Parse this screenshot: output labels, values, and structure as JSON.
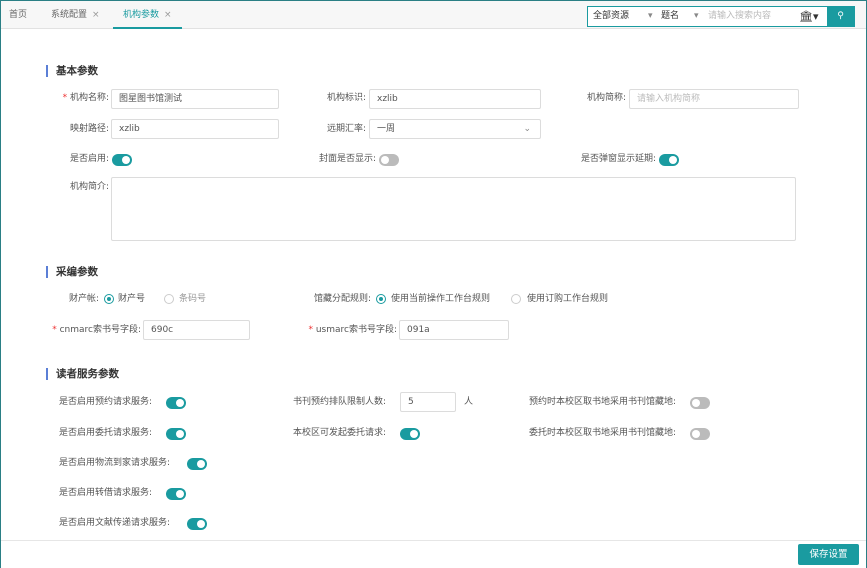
{
  "tabs": [
    {
      "label": "首页"
    },
    {
      "label": "系统配置",
      "close": "×"
    },
    {
      "label": "机构参数",
      "close": "×"
    }
  ],
  "search": {
    "scope": "全部资源",
    "field": "题名",
    "placeholder": "请输入搜索内容",
    "library_icon": "library-icon",
    "button_icon": "search-icon"
  },
  "basic": {
    "title": "基本参数",
    "name_label": "机构名称:",
    "name_value": "图星图书馆测试",
    "id_label": "机构标识:",
    "id_value": "xzlib",
    "abbr_label": "机构简称:",
    "abbr_placeholder": "请输入机构简称",
    "path_label": "映射路径:",
    "path_value": "xzlib",
    "rate_label": "远期汇率:",
    "rate_value": "一周",
    "enabled_label": "是否启用:",
    "enabled": true,
    "cover_label": "封面是否显示:",
    "cover": false,
    "popup_label": "是否弹窗显示延期:",
    "popup": true,
    "intro_label": "机构简介:",
    "intro_value": ""
  },
  "acq": {
    "title": "采编参数",
    "asset_label": "财产帐:",
    "asset_options": [
      "财产号",
      "条码号"
    ],
    "asset_selected": "财产号",
    "rule_label": "馆藏分配规则:",
    "rule_options": [
      "使用当前操作工作台规则",
      "使用订购工作台规则"
    ],
    "rule_selected": "使用当前操作工作台规则",
    "cnmarc_label": "cnmarc索书号字段:",
    "cnmarc_value": "690c",
    "usmarc_label": "usmarc索书号字段:",
    "usmarc_value": "091a"
  },
  "reader": {
    "title": "读者服务参数",
    "reserve_label": "是否启用预约请求服务:",
    "reserve": true,
    "queue_label": "书刊预约排队限制人数:",
    "queue_value": "5",
    "queue_unit": "人",
    "reserve_loc_label": "预约时本校区取书地采用书刊馆藏地:",
    "reserve_loc": false,
    "entrust_label": "是否启用委托请求服务:",
    "entrust": true,
    "campus_entrust_label": "本校区可发起委托请求:",
    "campus_entrust": true,
    "entrust_loc_label": "委托时本校区取书地采用书刊馆藏地:",
    "entrust_loc": false,
    "logistics_label": "是否启用物流到家请求服务:",
    "logistics": true,
    "transfer_label": "是否启用转借请求服务:",
    "transfer": true,
    "doc_label": "是否启用文献传递请求服务:",
    "doc": true
  },
  "footer": {
    "save_label": "保存设置"
  },
  "colors": {
    "accent": "#1a9ba0",
    "section_bar": "#5b7fd6",
    "required": "#e33333"
  }
}
